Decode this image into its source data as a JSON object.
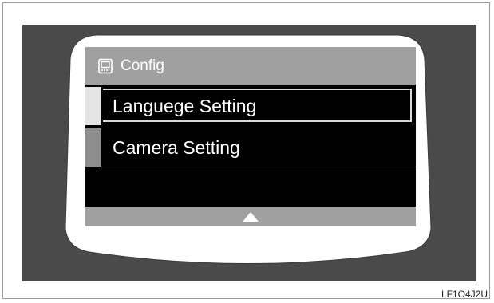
{
  "header": {
    "title": "Config",
    "icon": "config-icon"
  },
  "menu": {
    "items": [
      {
        "label": "Languege Setting",
        "state": "selected"
      },
      {
        "label": "Camera Setting",
        "state": "normal"
      }
    ]
  },
  "footer": {
    "scroll_icon": "up-arrow-icon"
  },
  "figure_code": "LF1O4J2U",
  "colors": {
    "panel": "#4a4a4a",
    "bar": "#a0a0a0",
    "screen": "#000000",
    "text": "#ffffff"
  }
}
